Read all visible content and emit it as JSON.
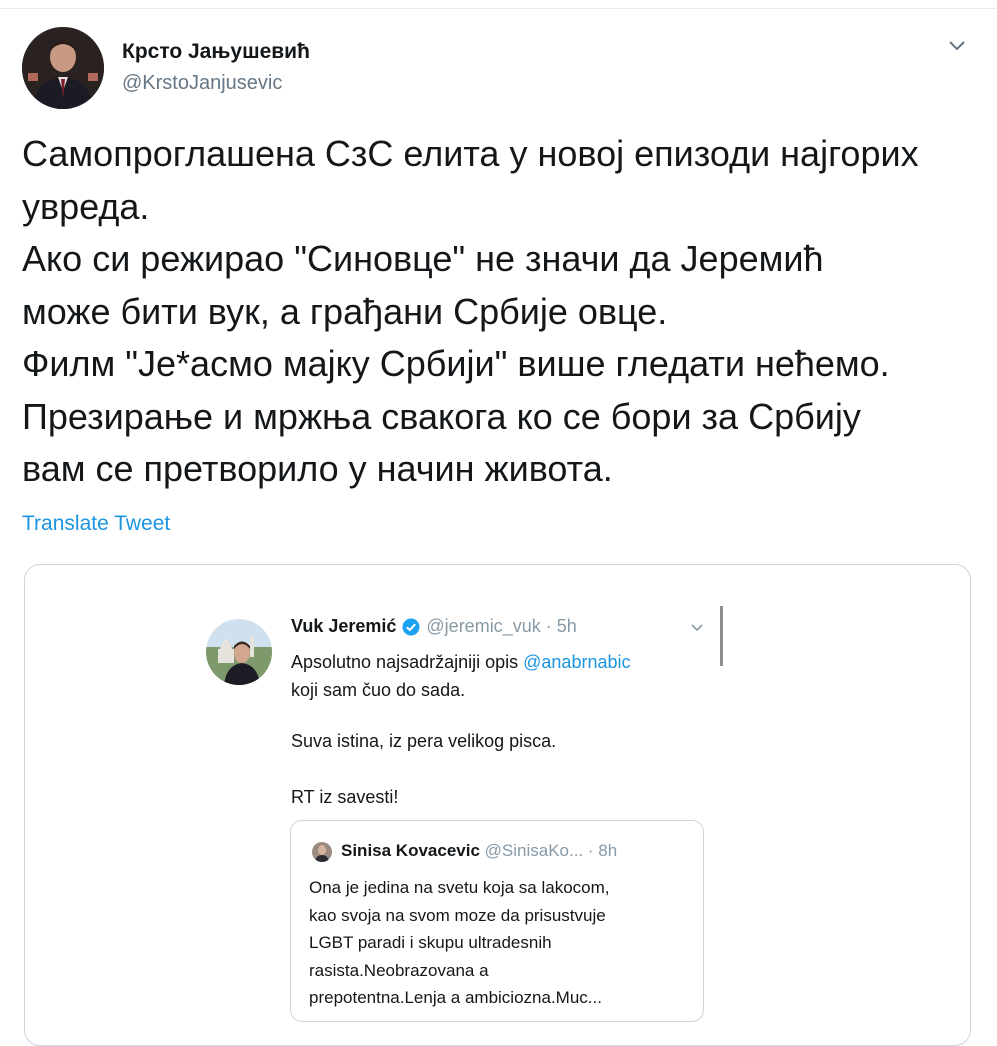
{
  "tweet": {
    "author_name": "Крсто Јањушевић",
    "author_handle": "@KrstoJanjusevic",
    "text_lines": [
      "Самопроглашена СзС елита у новој епизоди најгорих",
      "увреда.",
      "Ако си режирао \"Синовце\" не значи да Јеремић",
      "може бити вук, а грађани Србије овце.",
      "Филм \"Је*асмо мајку Србији\" више гледати нећемо.",
      "Презирање и мржња свакога ко се бори за Србију",
      "вам се претворило у начин живота."
    ],
    "translate_label": "Translate Tweet",
    "icons": {
      "avatar": "author-avatar",
      "menu": "chevron-down-icon"
    }
  },
  "embedded_tweet": {
    "author_name": "Vuk Jeremić",
    "handle_time": "@jeremic_vuk · 5h",
    "verified_color": "#1da1f2",
    "line1_text": "Apsolutno najsadržajniji opis ",
    "line1_mention": "@anabrnabic",
    "line2_text": "koji sam čuo do sada.",
    "paragraph2": "Suva istina, iz pera velikog pisca.",
    "paragraph3": "RT iz savesti!"
  },
  "quoted_tweet": {
    "author_name": "Sinisa Kovacevic",
    "handle_time": "@SinisaKo... · 8h",
    "text_lines": [
      "Ona je jedina na svetu koja sa lakocom,",
      "kao svoja na svom moze da prisustvuje",
      "LGBT paradi i skupu ultradesnih",
      "rasista.Neobrazovana a",
      "prepotentna.Lenja a ambiciozna.Muc..."
    ]
  },
  "colors": {
    "link": "#1b95e0",
    "secondary_text": "#657786",
    "border": "#ccd6dd"
  }
}
